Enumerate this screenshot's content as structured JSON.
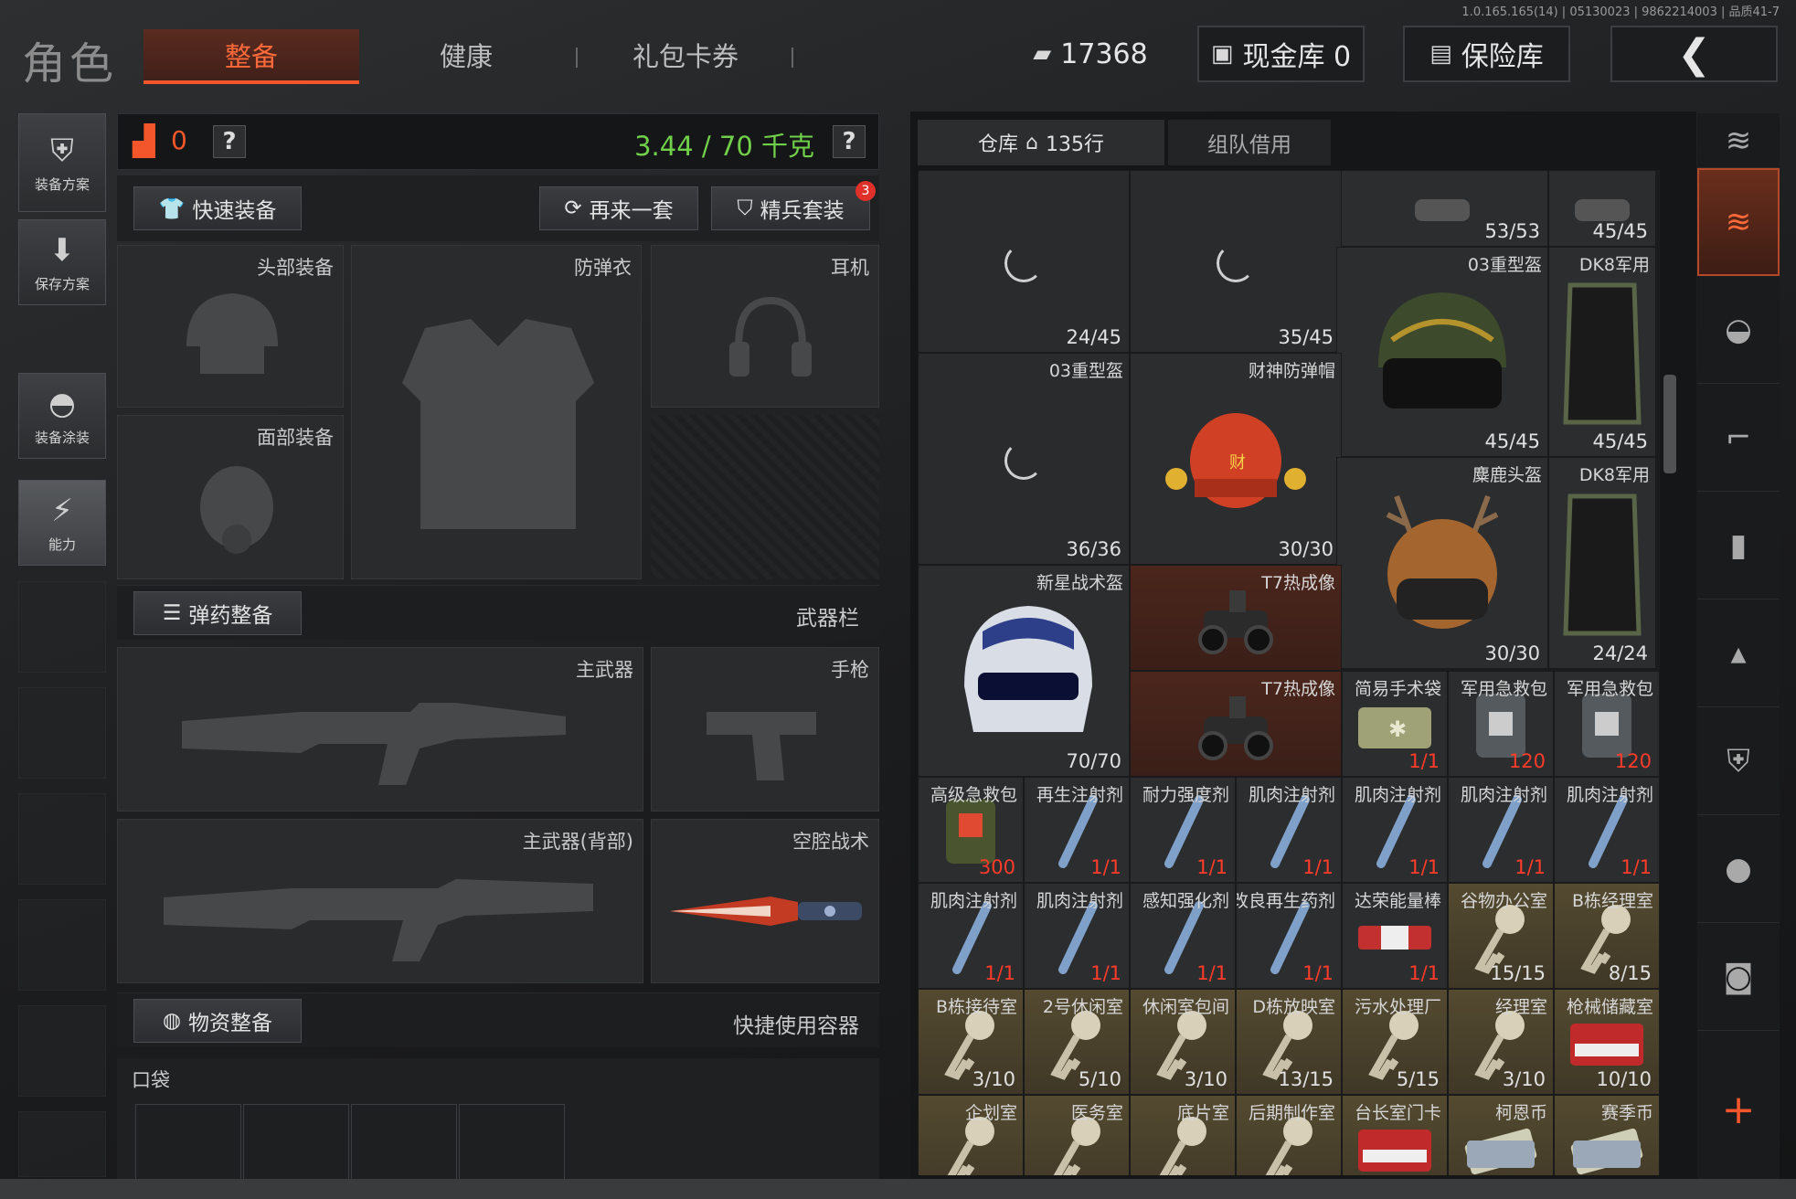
{
  "version_text": "1.0.165.165(14) | 05130023 | 9862214003 | 品质41-7",
  "header": {
    "title": "角色",
    "tabs": [
      {
        "label": "整备",
        "active": true
      },
      {
        "label": "健康",
        "active": false
      },
      {
        "label": "礼包卡券",
        "active": false
      }
    ],
    "currency": "17368",
    "cash_vault": "现金库 0",
    "safe_box": "保险库"
  },
  "sidebar": [
    {
      "label": "装备方案",
      "icon": "vest-icon"
    },
    {
      "label": "保存方案",
      "icon": "download-icon"
    },
    {
      "label": "装备涂装",
      "icon": "helmet-paint-icon"
    },
    {
      "label": "能力",
      "icon": "lightning-icon"
    }
  ],
  "loadout": {
    "bag_count": "0",
    "help": "?",
    "weight": "3.44 / 70 千克",
    "quick_equip": "快速装备",
    "again": "再来一套",
    "elite": "精兵套装",
    "elite_badge": "3",
    "slots": {
      "head": "头部装备",
      "armor": "防弹衣",
      "earphone": "耳机",
      "face": "面部装备",
      "primary": "主武器",
      "pistol": "手枪",
      "primary_back": "主武器(背部)",
      "tactical": "空腔战术"
    },
    "ammo_section": "弹药整备",
    "weapon_bar": "武器栏",
    "supply_section": "物资整备",
    "quick_container": "快捷使用容器",
    "pocket": "口袋"
  },
  "warehouse": {
    "tab_label": "仓库",
    "tab_count": "135行",
    "team_tab": "组队借用",
    "items": [
      {
        "name": "",
        "count": "53/53",
        "type": "gear"
      },
      {
        "name": "",
        "count": "45/45",
        "type": "gear"
      },
      {
        "name": "",
        "count": "24/45",
        "type": "loading"
      },
      {
        "name": "",
        "count": "35/45",
        "type": "loading"
      },
      {
        "name": "03重型盔",
        "count": "45/45",
        "type": "helmet"
      },
      {
        "name": "DK8军用",
        "count": "45/45",
        "type": "mask"
      },
      {
        "name": "03重型盔",
        "count": "36/36",
        "type": "loading"
      },
      {
        "name": "财神防弹帽",
        "count": "30/30",
        "type": "hat"
      },
      {
        "name": "麋鹿头盔",
        "count": "30/30",
        "type": "deer"
      },
      {
        "name": "DK8军用",
        "count": "24/24",
        "type": "mask"
      },
      {
        "name": "新星战术盔",
        "count": "70/70",
        "type": "nova"
      },
      {
        "name": "T7热成像",
        "count": "",
        "type": "thermal"
      },
      {
        "name": "T7热成像",
        "count": "",
        "type": "thermal"
      },
      {
        "name": "简易手术袋",
        "count": "1/1",
        "type": "pouch"
      },
      {
        "name": "军用急救包",
        "count": "120",
        "type": "medkit"
      },
      {
        "name": "军用急救包",
        "count": "120",
        "type": "medkit"
      },
      {
        "name": "高级急救包",
        "count": "300",
        "type": "adv"
      },
      {
        "name": "再生注射剂",
        "count": "1/1",
        "type": "inj"
      },
      {
        "name": "耐力强度剂",
        "count": "1/1",
        "type": "inj"
      },
      {
        "name": "肌肉注射剂",
        "count": "1/1",
        "type": "inj"
      },
      {
        "name": "肌肉注射剂",
        "count": "1/1",
        "type": "inj"
      },
      {
        "name": "肌肉注射剂",
        "count": "1/1",
        "type": "inj"
      },
      {
        "name": "肌肉注射剂",
        "count": "1/1",
        "type": "inj"
      },
      {
        "name": "肌肉注射剂",
        "count": "1/1",
        "type": "inj"
      },
      {
        "name": "肌肉注射剂",
        "count": "1/1",
        "type": "inj"
      },
      {
        "name": "感知强化剂",
        "count": "1/1",
        "type": "inj"
      },
      {
        "name": "改良再生药剂",
        "count": "1/1",
        "type": "inj"
      },
      {
        "name": "达荣能量棒",
        "count": "1/1",
        "type": "bar"
      },
      {
        "name": "谷物办公室",
        "count": "15/15",
        "type": "key"
      },
      {
        "name": "B栋经理室",
        "count": "8/15",
        "type": "key"
      },
      {
        "name": "B栋接待室",
        "count": "3/10",
        "type": "key"
      },
      {
        "name": "2号休闲室",
        "count": "5/10",
        "type": "key"
      },
      {
        "name": "休闲室包间",
        "count": "3/10",
        "type": "key"
      },
      {
        "name": "D栋放映室",
        "count": "13/15",
        "type": "key"
      },
      {
        "name": "污水处理厂",
        "count": "5/15",
        "type": "key"
      },
      {
        "name": "经理室",
        "count": "3/10",
        "type": "key"
      },
      {
        "name": "枪械储藏室",
        "count": "10/10",
        "type": "card"
      },
      {
        "name": "企划室",
        "count": "",
        "type": "key"
      },
      {
        "name": "医务室",
        "count": "",
        "type": "key"
      },
      {
        "name": "底片室",
        "count": "",
        "type": "key"
      },
      {
        "name": "后期制作室",
        "count": "",
        "type": "key"
      },
      {
        "name": "台长室门卡",
        "count": "",
        "type": "card"
      },
      {
        "name": "柯恩币",
        "count": "",
        "type": "coin"
      },
      {
        "name": "赛季币",
        "count": "",
        "type": "coin"
      }
    ]
  },
  "right_bar": [
    "hat-stack-icon",
    "hat-stack-icon",
    "helmet-icon",
    "rifle-icon",
    "magazine-icon",
    "bullet-icon",
    "armor-icon",
    "grenade-icon",
    "cup-icon",
    "plus-icon"
  ],
  "colors": {
    "accent": "#f2562a",
    "weight_green": "#71d04a",
    "count_red": "#ff3b2a"
  }
}
